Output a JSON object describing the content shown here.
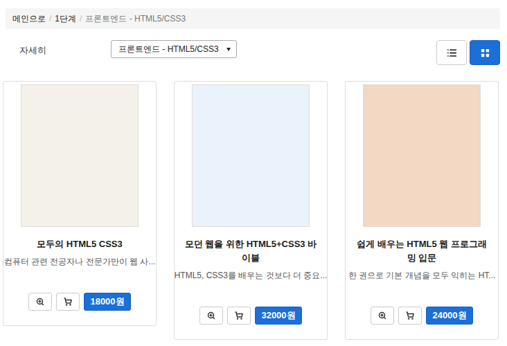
{
  "breadcrumb": {
    "separator": "/",
    "items": [
      {
        "label": "메인으로",
        "current": false
      },
      {
        "label": "1단계",
        "current": false
      },
      {
        "label": "프론트엔드 - HTML5/CSS3",
        "current": true
      }
    ]
  },
  "toolbar": {
    "label": "자세히",
    "select": {
      "value": "프론트엔드 - HTML5/CSS3"
    },
    "views": [
      {
        "kind": "list",
        "selected": false
      },
      {
        "kind": "grid",
        "selected": true
      }
    ]
  },
  "products": [
    {
      "title": "모두의 HTML5 CSS3",
      "description": "컴퓨터 관련 전공자나 전문가만이 웹 사...",
      "price": "18000원",
      "cover": "#f4f1ea"
    },
    {
      "title": "모던 웹을 위한 HTML5+CSS3 바이블",
      "description": "HTML5, CSS3를 배우는 것보다 더 중요...",
      "price": "32000원",
      "cover": "#eaf2fb"
    },
    {
      "title": "쉽게 배우는 HTML5 웹 프로그래밍 입문",
      "description": "한 권으로 기본 개념을 모두 익히는 HT...",
      "price": "24000원",
      "cover": "#f3d8c4"
    }
  ]
}
